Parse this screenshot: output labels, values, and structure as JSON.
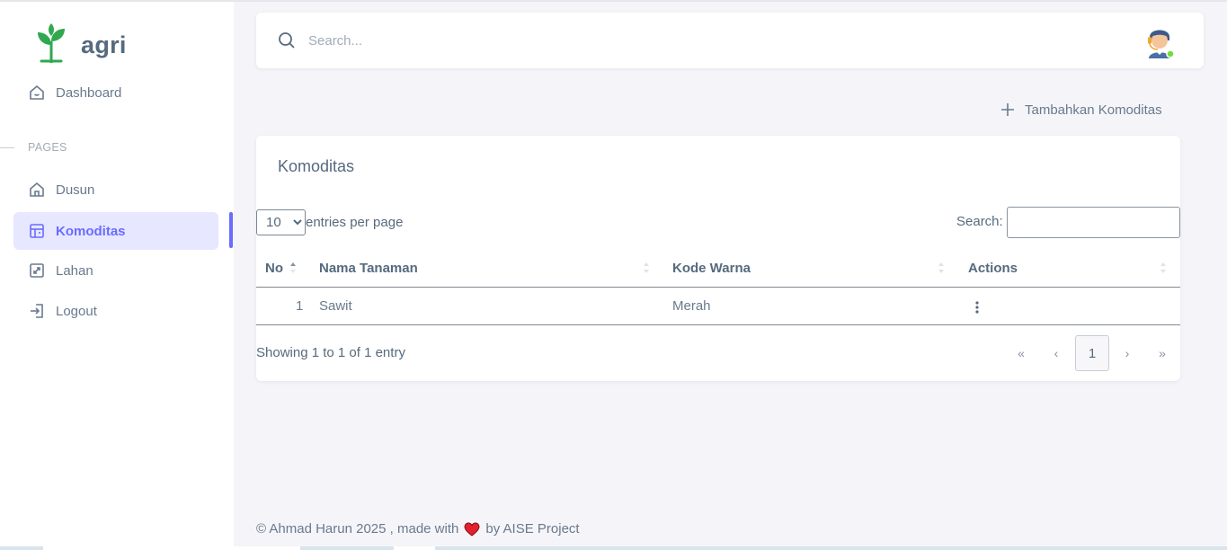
{
  "brand": {
    "name": "agri"
  },
  "sidebar": {
    "section_header": "PAGES",
    "items": [
      {
        "label": "Dashboard"
      },
      {
        "label": "Dusun"
      },
      {
        "label": "Komoditas"
      },
      {
        "label": "Lahan"
      },
      {
        "label": "Logout"
      }
    ]
  },
  "navbar": {
    "search_placeholder": "Search..."
  },
  "actions": {
    "add_label": "Tambahkan Komoditas"
  },
  "card": {
    "title": "Komoditas",
    "entries_value": "10",
    "entries_label": "entries per page",
    "search_label": "Search:",
    "columns": [
      "No",
      "Nama Tanaman",
      "Kode Warna",
      "Actions"
    ],
    "rows": [
      {
        "no": "1",
        "nama": "Sawit",
        "warna": "Merah"
      }
    ],
    "info": "Showing 1 to 1 of 1 entry",
    "pagination": {
      "first": "«",
      "prev": "‹",
      "current": "1",
      "next": "›",
      "last": "»"
    }
  },
  "footer": {
    "prefix": "© Ahmad Harun 2025 , made with",
    "suffix": "by AISE Project"
  },
  "colors": {
    "primary": "#696cff",
    "brand_green": "#2fa84f",
    "heart": "#e4202d"
  }
}
